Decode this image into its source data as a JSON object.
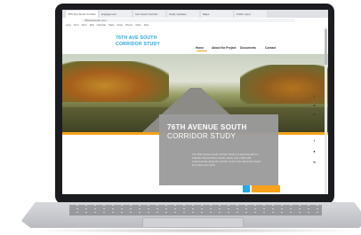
{
  "browser": {
    "tabs": [
      "76th Ave South Corridor",
      "Engagement",
      "Ave South Corridor",
      "Study Updates",
      "Maps",
      "Public Input"
    ],
    "url": "76thavesouth.com",
    "bookmarks": [
      "Apps",
      "Docs",
      "Drive",
      "Mail",
      "Calendar",
      "Maps",
      "News",
      "Photos",
      "Video",
      "Sites"
    ]
  },
  "site": {
    "logo_line1": "76TH AVE SOUTH",
    "logo_line2": "CORRIDOR STUDY",
    "nav": [
      "Home",
      "About the Project",
      "Documents",
      "Contact"
    ]
  },
  "hero": {
    "title_line1": "76TH AVENUE SOUTH",
    "title_line2": "CORRIDOR STUDY",
    "body": "The 76th Avenue South Corridor Study is a planning effort to evaluate transportation needs, safety, and multimodal improvements along the corridor. Learn more about the project and share your input."
  },
  "social_icons": [
    "facebook-icon",
    "twitter-icon",
    "linkedin-icon",
    "facebook-icon",
    "twitter-icon",
    "linkedin-icon"
  ],
  "colors": {
    "accent_blue": "#27a9e1",
    "accent_orange": "#f6a21a",
    "card_gray": "#9b9b9b"
  }
}
